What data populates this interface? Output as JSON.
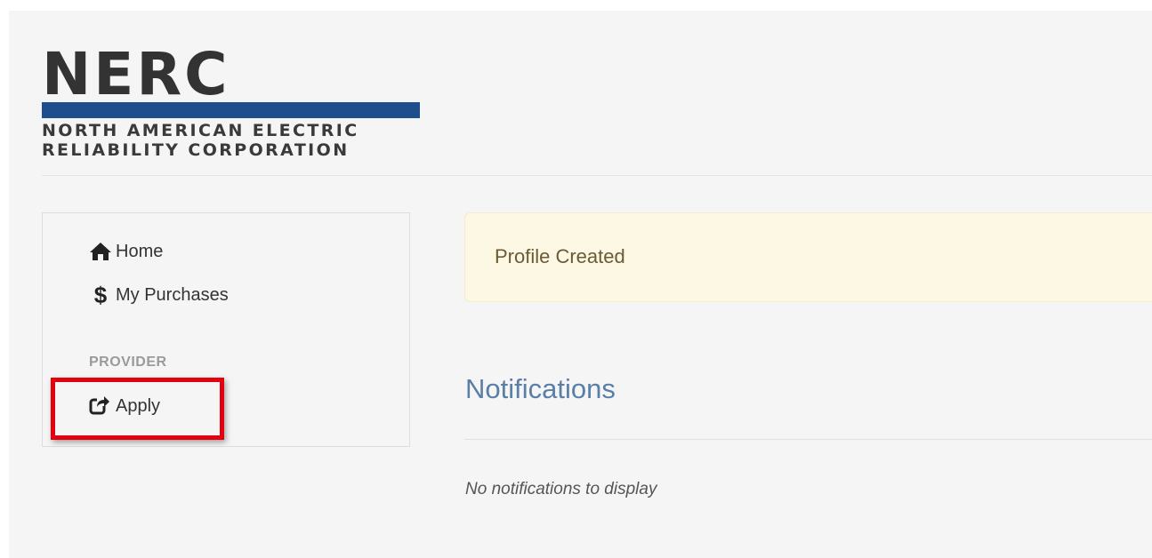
{
  "logo": {
    "wordmark": "NERC",
    "line1": "NORTH AMERICAN ELECTRIC",
    "line2": "RELIABILITY CORPORATION",
    "bar_color": "#1f4e8c"
  },
  "sidebar": {
    "items": [
      {
        "label": "Home",
        "icon": "home-icon"
      },
      {
        "label": "My Purchases",
        "icon": "dollar-icon",
        "icon_glyph": "$"
      }
    ],
    "section_label": "PROVIDER",
    "section_items": [
      {
        "label": "Apply",
        "icon": "share-square-icon"
      }
    ],
    "highlight_color": "#e3000f"
  },
  "alert": {
    "text": "Profile Created"
  },
  "notifications": {
    "title": "Notifications",
    "empty_text": "No notifications to display"
  }
}
